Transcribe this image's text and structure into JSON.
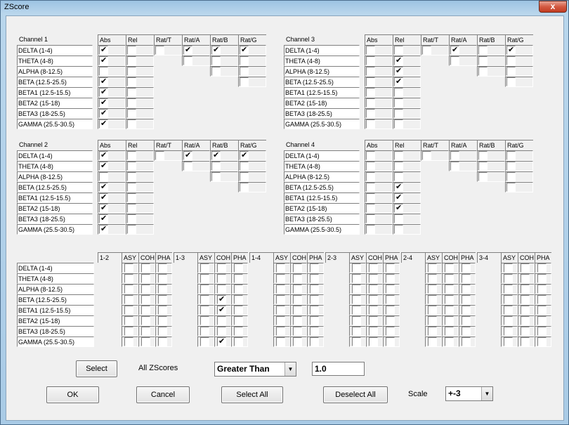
{
  "window": {
    "title": "ZScore",
    "close_glyph": "x"
  },
  "bands": [
    "DELTA (1-4)",
    "THETA (4-8)",
    "ALPHA (8-12.5)",
    "BETA (12.5-25.5)",
    "BETA1 (12.5-15.5)",
    "BETA2 (15-18)",
    "BETA3 (18-25.5)",
    "GAMMA (25.5-30.5)"
  ],
  "channel_columns": [
    "Abs",
    "Rel",
    "Rat/T",
    "Rat/A",
    "Rat/B",
    "Rat/G"
  ],
  "channels": [
    {
      "name": "Channel 1",
      "abs": [
        1,
        1,
        0,
        1,
        1,
        1,
        1,
        1
      ],
      "rel": [
        0,
        0,
        0,
        0,
        0,
        0,
        0,
        0
      ],
      "ratio_row1": [
        0,
        1,
        1,
        1
      ],
      "ratio_row2": [
        0,
        0,
        0
      ],
      "ratio_row3": [
        0,
        0
      ],
      "ratio_row4": [
        0
      ]
    },
    {
      "name": "Channel 3",
      "abs": [
        0,
        0,
        0,
        0,
        0,
        0,
        0,
        0
      ],
      "rel": [
        0,
        1,
        1,
        1,
        0,
        0,
        0,
        0
      ],
      "ratio_row1": [
        0,
        1,
        0,
        1
      ],
      "ratio_row2": [
        0,
        0,
        0
      ],
      "ratio_row3": [
        0,
        0
      ],
      "ratio_row4": [
        0
      ]
    },
    {
      "name": "Channel 2",
      "abs": [
        1,
        1,
        0,
        1,
        1,
        1,
        1,
        1
      ],
      "rel": [
        0,
        0,
        0,
        0,
        0,
        0,
        0,
        0
      ],
      "ratio_row1": [
        0,
        1,
        1,
        1
      ],
      "ratio_row2": [
        0,
        0,
        0
      ],
      "ratio_row3": [
        0,
        0
      ],
      "ratio_row4": [
        0
      ]
    },
    {
      "name": "Channel 4",
      "abs": [
        0,
        0,
        0,
        0,
        0,
        0,
        0,
        0
      ],
      "rel": [
        0,
        0,
        0,
        1,
        1,
        1,
        0,
        0
      ],
      "ratio_row1": [
        0,
        0,
        0,
        0
      ],
      "ratio_row2": [
        0,
        0,
        0
      ],
      "ratio_row3": [
        0,
        0
      ],
      "ratio_row4": [
        0
      ]
    }
  ],
  "pair_columns": [
    "ASY",
    "COH",
    "PHA"
  ],
  "pairs": [
    {
      "name": "1-2",
      "asy": [
        0,
        0,
        0,
        0,
        0,
        0,
        0,
        0
      ],
      "coh": [
        0,
        0,
        0,
        0,
        0,
        0,
        0,
        0
      ],
      "pha": [
        0,
        0,
        0,
        0,
        0,
        0,
        0,
        0
      ]
    },
    {
      "name": "1-3",
      "asy": [
        0,
        0,
        0,
        0,
        0,
        0,
        0,
        0
      ],
      "coh": [
        0,
        0,
        0,
        1,
        1,
        0,
        0,
        1
      ],
      "pha": [
        0,
        0,
        0,
        0,
        0,
        0,
        0,
        0
      ]
    },
    {
      "name": "1-4",
      "asy": [
        0,
        0,
        0,
        0,
        0,
        0,
        0,
        0
      ],
      "coh": [
        0,
        0,
        0,
        0,
        0,
        0,
        0,
        0
      ],
      "pha": [
        0,
        0,
        0,
        0,
        0,
        0,
        0,
        0
      ]
    },
    {
      "name": "2-3",
      "asy": [
        0,
        0,
        0,
        0,
        0,
        0,
        0,
        0
      ],
      "coh": [
        0,
        0,
        0,
        0,
        0,
        0,
        0,
        0
      ],
      "pha": [
        0,
        0,
        0,
        0,
        0,
        0,
        0,
        0
      ]
    },
    {
      "name": "2-4",
      "asy": [
        0,
        0,
        0,
        0,
        0,
        0,
        0,
        0
      ],
      "coh": [
        0,
        0,
        0,
        0,
        0,
        0,
        0,
        0
      ],
      "pha": [
        0,
        0,
        0,
        0,
        0,
        0,
        0,
        0
      ]
    },
    {
      "name": "3-4",
      "asy": [
        0,
        0,
        0,
        0,
        0,
        0,
        0,
        0
      ],
      "coh": [
        0,
        0,
        0,
        0,
        0,
        0,
        0,
        0
      ],
      "pha": [
        0,
        0,
        0,
        0,
        0,
        0,
        0,
        0
      ]
    }
  ],
  "controls": {
    "select_label": "Select",
    "all_zscores_label": "All ZScores",
    "comparison_value": "Greater Than",
    "threshold_value": "1.0",
    "ok_label": "OK",
    "cancel_label": "Cancel",
    "select_all_label": "Select All",
    "deselect_all_label": "Deselect All",
    "scale_label": "Scale",
    "scale_value": "+-3",
    "dropdown_glyph": "▼"
  }
}
